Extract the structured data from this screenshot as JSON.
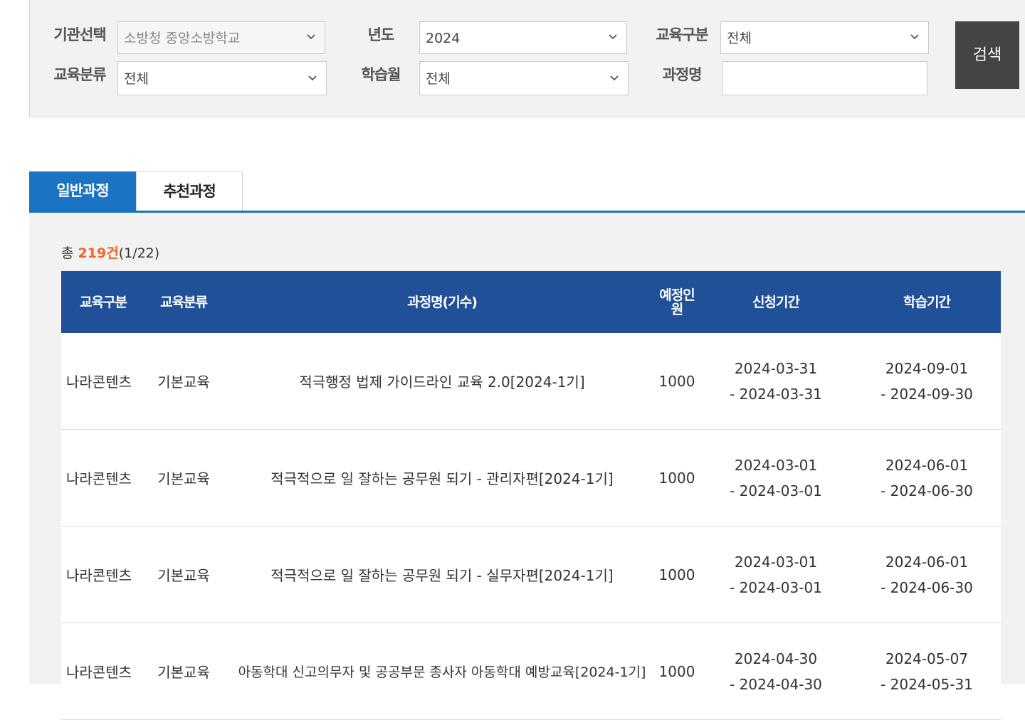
{
  "search": {
    "agency_label": "기관선택",
    "agency_value": "소방청 중앙소방학교",
    "year_label": "년도",
    "year_value": "2024",
    "edu_type_label": "교육구분",
    "edu_type_value": "전체",
    "edu_category_label": "교육분류",
    "edu_category_value": "전체",
    "month_label": "학습월",
    "month_value": "전체",
    "course_name_label": "과정명",
    "course_name_value": "",
    "search_button": "검색"
  },
  "tabs": [
    {
      "label": "일반과정",
      "active": true
    },
    {
      "label": "추천과정",
      "active": false
    }
  ],
  "summary": {
    "prefix": "총",
    "count": "219건",
    "pages": "(1/22)"
  },
  "table": {
    "headers": [
      "교육구분",
      "교육분류",
      "과정명(기수)",
      "예정인원",
      "신청기간",
      "학습기간"
    ],
    "rows": [
      {
        "type": "나라콘텐츠",
        "category": "기본교육",
        "course": "적극행정 법제 가이드라인 교육 2.0[2024-1기]",
        "capacity": "1000",
        "apply_start": "2024-03-31",
        "apply_end": "- 2024-03-31",
        "study_start": "2024-09-01",
        "study_end": "- 2024-09-30"
      },
      {
        "type": "나라콘텐츠",
        "category": "기본교육",
        "course": "적극적으로 일 잘하는 공무원 되기 - 관리자편[2024-1기]",
        "capacity": "1000",
        "apply_start": "2024-03-01",
        "apply_end": "- 2024-03-01",
        "study_start": "2024-06-01",
        "study_end": "- 2024-06-30"
      },
      {
        "type": "나라콘텐츠",
        "category": "기본교육",
        "course": "적극적으로 일 잘하는 공무원 되기 - 실무자편[2024-1기]",
        "capacity": "1000",
        "apply_start": "2024-03-01",
        "apply_end": "- 2024-03-01",
        "study_start": "2024-06-01",
        "study_end": "- 2024-06-30"
      },
      {
        "type": "나라콘텐츠",
        "category": "기본교육",
        "course": "아동학대 신고의무자 및 공공부문 종사자 아동학대 예방교육[2024-1기]",
        "capacity": "1000",
        "apply_start": "2024-04-30",
        "apply_end": "- 2024-04-30",
        "study_start": "2024-05-07",
        "study_end": "- 2024-05-31"
      }
    ]
  }
}
